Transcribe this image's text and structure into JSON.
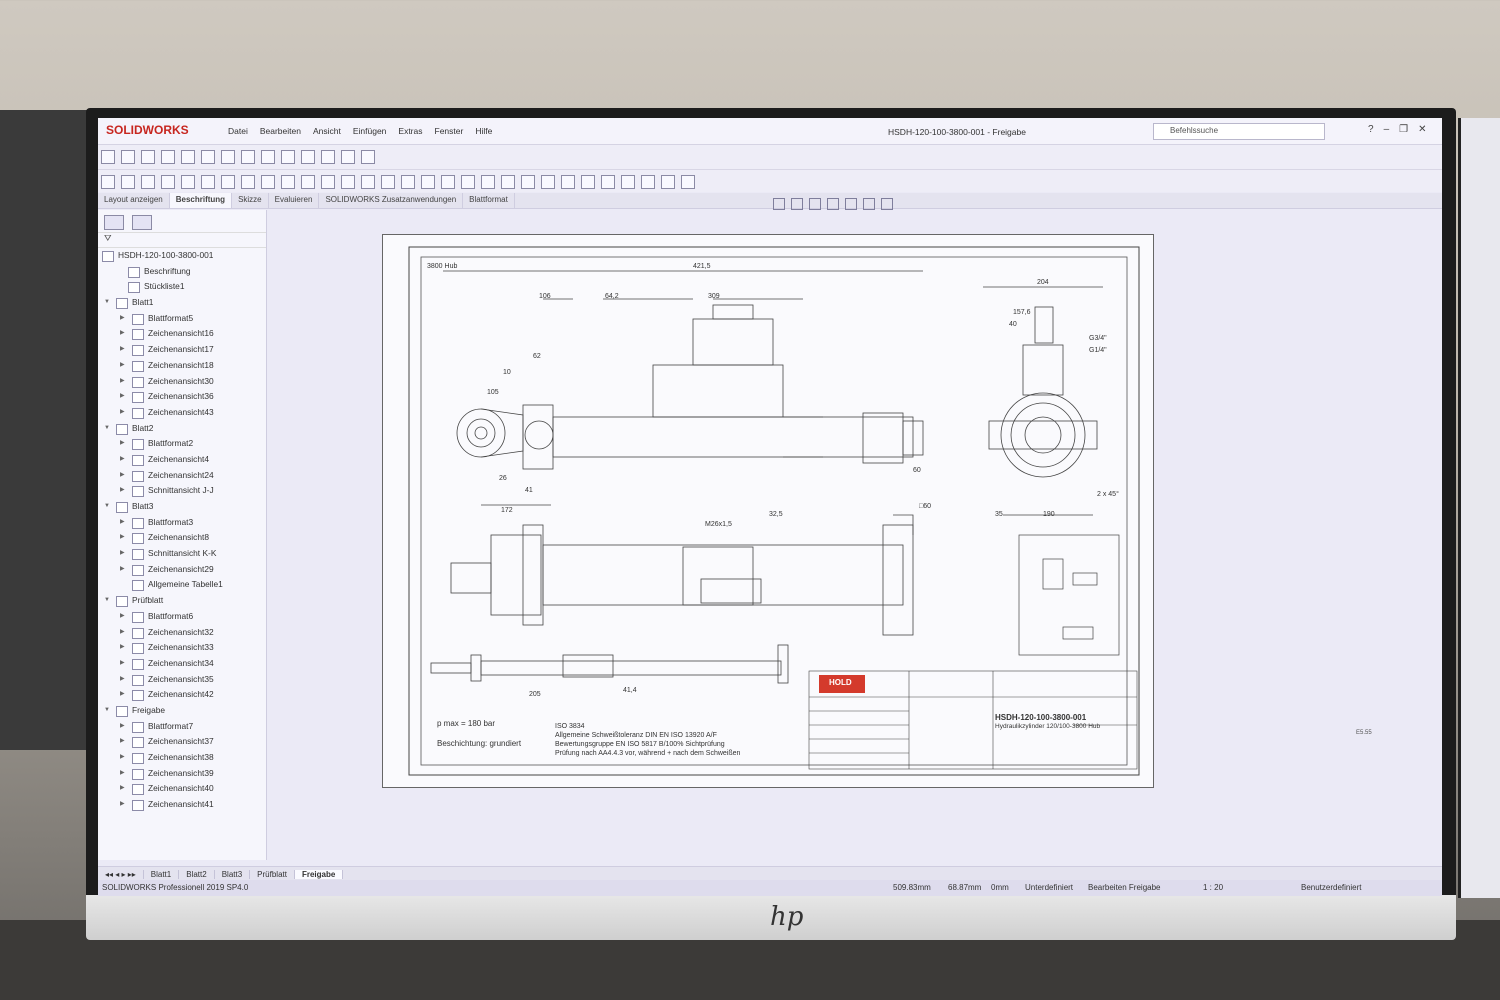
{
  "app": {
    "logo": "SOLIDWORKS",
    "document_title": "HSDH-120-100-3800-001 - Freigabe",
    "search_placeholder": "Befehlssuche",
    "version": "SOLIDWORKS Professionell 2019 SP4.0"
  },
  "menu": [
    "Datei",
    "Bearbeiten",
    "Ansicht",
    "Einfügen",
    "Extras",
    "Fenster",
    "Hilfe"
  ],
  "tabs": [
    "Layout anzeigen",
    "Beschriftung",
    "Skizze",
    "Evaluieren",
    "SOLIDWORKS Zusatzanwendungen",
    "Blattformat"
  ],
  "active_tab": "Beschriftung",
  "tree": {
    "root": "HSDH-120-100-3800-001",
    "items": [
      {
        "label": "Beschriftung",
        "level": 1,
        "expandable": false
      },
      {
        "label": "Stückliste1",
        "level": 1,
        "expandable": false
      },
      {
        "label": "Blatt1",
        "level": 0,
        "expandable": true
      },
      {
        "label": "Blattformat5",
        "level": 2,
        "expandable": true
      },
      {
        "label": "Zeichenansicht16",
        "level": 2,
        "expandable": true
      },
      {
        "label": "Zeichenansicht17",
        "level": 2,
        "expandable": true
      },
      {
        "label": "Zeichenansicht18",
        "level": 2,
        "expandable": true
      },
      {
        "label": "Zeichenansicht30",
        "level": 2,
        "expandable": true
      },
      {
        "label": "Zeichenansicht36",
        "level": 2,
        "expandable": true
      },
      {
        "label": "Zeichenansicht43",
        "level": 2,
        "expandable": true
      },
      {
        "label": "Blatt2",
        "level": 0,
        "expandable": true
      },
      {
        "label": "Blattformat2",
        "level": 2,
        "expandable": true
      },
      {
        "label": "Zeichenansicht4",
        "level": 2,
        "expandable": true
      },
      {
        "label": "Zeichenansicht24",
        "level": 2,
        "expandable": true
      },
      {
        "label": "Schnittansicht J-J",
        "level": 2,
        "expandable": true
      },
      {
        "label": "Blatt3",
        "level": 0,
        "expandable": true
      },
      {
        "label": "Blattformat3",
        "level": 2,
        "expandable": true
      },
      {
        "label": "Zeichenansicht8",
        "level": 2,
        "expandable": true
      },
      {
        "label": "Schnittansicht K-K",
        "level": 2,
        "expandable": true
      },
      {
        "label": "Zeichenansicht29",
        "level": 2,
        "expandable": true
      },
      {
        "label": "Allgemeine Tabelle1",
        "level": 2,
        "expandable": false
      },
      {
        "label": "Prüfblatt",
        "level": 0,
        "expandable": true
      },
      {
        "label": "Blattformat6",
        "level": 2,
        "expandable": true
      },
      {
        "label": "Zeichenansicht32",
        "level": 2,
        "expandable": true
      },
      {
        "label": "Zeichenansicht33",
        "level": 2,
        "expandable": true
      },
      {
        "label": "Zeichenansicht34",
        "level": 2,
        "expandable": true
      },
      {
        "label": "Zeichenansicht35",
        "level": 2,
        "expandable": true
      },
      {
        "label": "Zeichenansicht42",
        "level": 2,
        "expandable": true
      },
      {
        "label": "Freigabe",
        "level": 0,
        "expandable": true
      },
      {
        "label": "Blattformat7",
        "level": 2,
        "expandable": true
      },
      {
        "label": "Zeichenansicht37",
        "level": 2,
        "expandable": true
      },
      {
        "label": "Zeichenansicht38",
        "level": 2,
        "expandable": true
      },
      {
        "label": "Zeichenansicht39",
        "level": 2,
        "expandable": true
      },
      {
        "label": "Zeichenansicht40",
        "level": 2,
        "expandable": true
      },
      {
        "label": "Zeichenansicht41",
        "level": 2,
        "expandable": true
      }
    ]
  },
  "drawing": {
    "dims": [
      "3800 Hub",
      "421,5",
      "106",
      "64,2",
      "309",
      "62",
      "10",
      "105",
      "26",
      "41",
      "172",
      "204",
      "157,6",
      "40",
      "G3/4\"",
      "G1/4\"",
      "60",
      "35",
      "190",
      "2 x 45°",
      "M26x1,5",
      "32,5",
      "205",
      "41,4",
      "□60"
    ],
    "notes": [
      "p max = 180 bar",
      "Beschichtung: grundiert"
    ],
    "iso_notes": [
      "ISO 3834",
      "Allgemeine Schweißtoleranz DIN EN ISO 13920 A/F",
      "Bewertungsgruppe EN ISO 5817 B/100% Sichtprüfung",
      "Prüfung nach AA4.4.3 vor, während + nach dem Schweißen"
    ],
    "title_block": {
      "company": "HOLD",
      "part_number": "HSDH-120-100-3800-001",
      "description": "Hydraulikzylinder 120/100-3800 Hub"
    }
  },
  "sheet_tabs": [
    "Blatt1",
    "Blatt2",
    "Blatt3",
    "Prüfblatt",
    "Freigabe"
  ],
  "active_sheet": "Freigabe",
  "status": {
    "x": "509.83mm",
    "y": "68.87mm",
    "z": "0mm",
    "state": "Unterdefiniert",
    "mode": "Bearbeiten Freigabe",
    "scale": "1 : 20",
    "units": "Benutzerdefiniert"
  }
}
